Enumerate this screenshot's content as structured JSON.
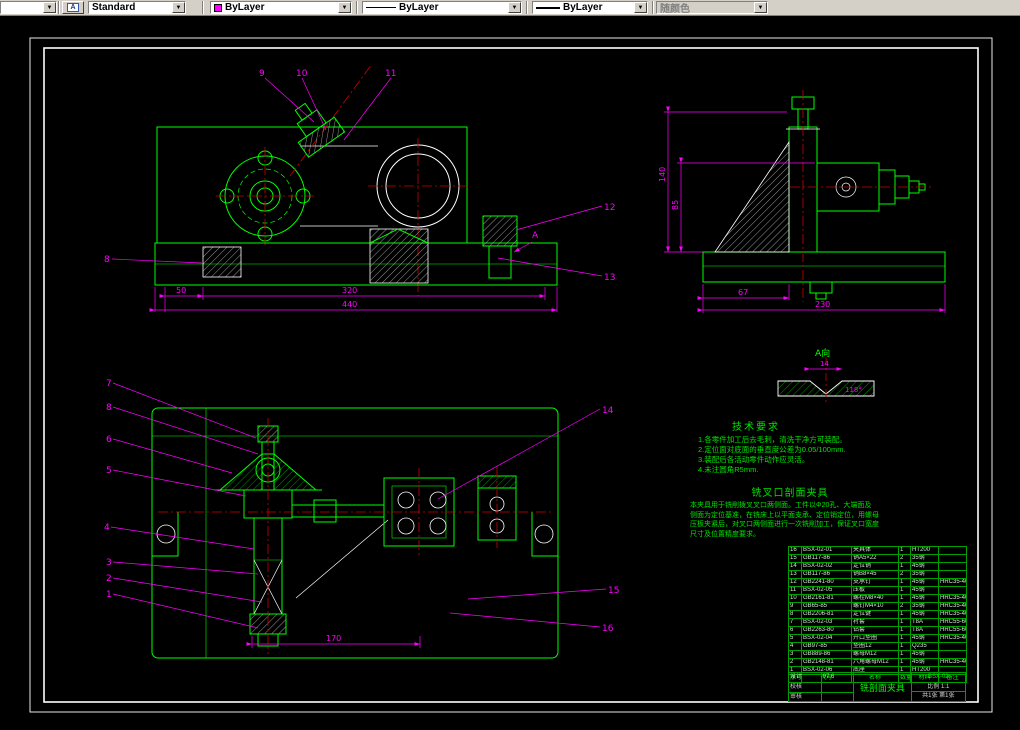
{
  "toolbar": {
    "left_value": "",
    "style_icon_glyph": "A",
    "text_style": "Standard",
    "color": "ByLayer",
    "linetype": "ByLayer",
    "lineweight": "ByLayer",
    "plot_style": "随颜色"
  },
  "colors": {
    "geometry_green": "#00ff00",
    "annotation_magenta": "#ff00ff",
    "centerline_red": "#cc0000",
    "edge_white": "#ffffff"
  },
  "callouts": {
    "front": [
      "9",
      "10",
      "11",
      "8",
      "12",
      "13"
    ],
    "plan_left": [
      "7",
      "8",
      "6",
      "5",
      "4",
      "3",
      "2",
      "1"
    ],
    "plan_right": [
      "14",
      "15",
      "16"
    ]
  },
  "dims": {
    "front": [
      "50",
      "320",
      "440"
    ],
    "side_left": [
      "140",
      "85"
    ],
    "side_bottom": [
      "67",
      "230"
    ],
    "plan": [
      "170"
    ],
    "detail": {
      "label": "A向",
      "width": "14",
      "angle": "118°"
    },
    "section_marker": "A"
  },
  "tech_req": {
    "title": "技术要求",
    "lines": [
      "1.各零件加工后去毛刺，清洗干净方可装配。",
      "2.定位面对底面的垂直度公差为0.05/100mm.",
      "3.装配后各活动零件动作应灵活。",
      "4.未注圆角R5mm."
    ]
  },
  "description": {
    "title": "铣叉口剖面夹具",
    "lines": [
      "本夹具用于铣削拨叉叉口两侧面。工件以Φ20孔、大端面及",
      "侧面为定位基准，在铣床上以平面支承、定位销定位，用螺母",
      "压板夹紧后，对叉口两侧面进行一次铣削加工，保证叉口宽度",
      "尺寸及位置精度要求。"
    ]
  },
  "bom": {
    "headers": [
      "序号",
      "代号",
      "名称",
      "数量",
      "材料",
      "备注"
    ],
    "rows": [
      [
        "16",
        "BSX-02-01",
        "夹具体",
        "1",
        "HT200",
        ""
      ],
      [
        "15",
        "GB117-86",
        "销A5×22",
        "2",
        "35钢",
        ""
      ],
      [
        "14",
        "BSX-02-02",
        "定位销",
        "1",
        "45钢",
        ""
      ],
      [
        "13",
        "GB117-86",
        "销B8×45",
        "2",
        "35钢",
        ""
      ],
      [
        "12",
        "GB2241-80",
        "支承钉",
        "1",
        "45钢",
        "HRC35-40"
      ],
      [
        "11",
        "BSX-02-05",
        "压板",
        "1",
        "45钢",
        ""
      ],
      [
        "10",
        "GB2161-81",
        "螺栓M8×40",
        "1",
        "45钢",
        "HRC35-40"
      ],
      [
        "9",
        "GB65-85",
        "螺钉M4×10",
        "2",
        "35钢",
        "HRC35-40"
      ],
      [
        "8",
        "GB2206-81",
        "定位键",
        "1",
        "45钢",
        "HRC35-40"
      ],
      [
        "7",
        "BSX-02-03",
        "衬套",
        "1",
        "T8A",
        "HRC55-60"
      ],
      [
        "6",
        "GB2263-80",
        "钻套",
        "1",
        "T8A",
        "HRC55-60"
      ],
      [
        "5",
        "BSX-02-04",
        "开口垫圈",
        "1",
        "45钢",
        "HRC35-40"
      ],
      [
        "4",
        "GB97-85",
        "垫圈12",
        "1",
        "Q235",
        ""
      ],
      [
        "3",
        "GB889-86",
        "螺母M12",
        "1",
        "45钢",
        ""
      ],
      [
        "2",
        "GB2148-81",
        "六角螺母M12",
        "1",
        "45钢",
        "HRC35-40"
      ],
      [
        "1",
        "BSX-02-06",
        "底座",
        "1",
        "HT200",
        ""
      ]
    ]
  },
  "titleblock": {
    "design_label": "设计",
    "design_date": "07.6",
    "check_label": "校核",
    "audit_label": "审核",
    "part_name": "铣剖面夹具",
    "drawing_no": "BSX-02",
    "scale_label": "比例",
    "scale": "1:1",
    "sheet": "共1张 第1张"
  }
}
